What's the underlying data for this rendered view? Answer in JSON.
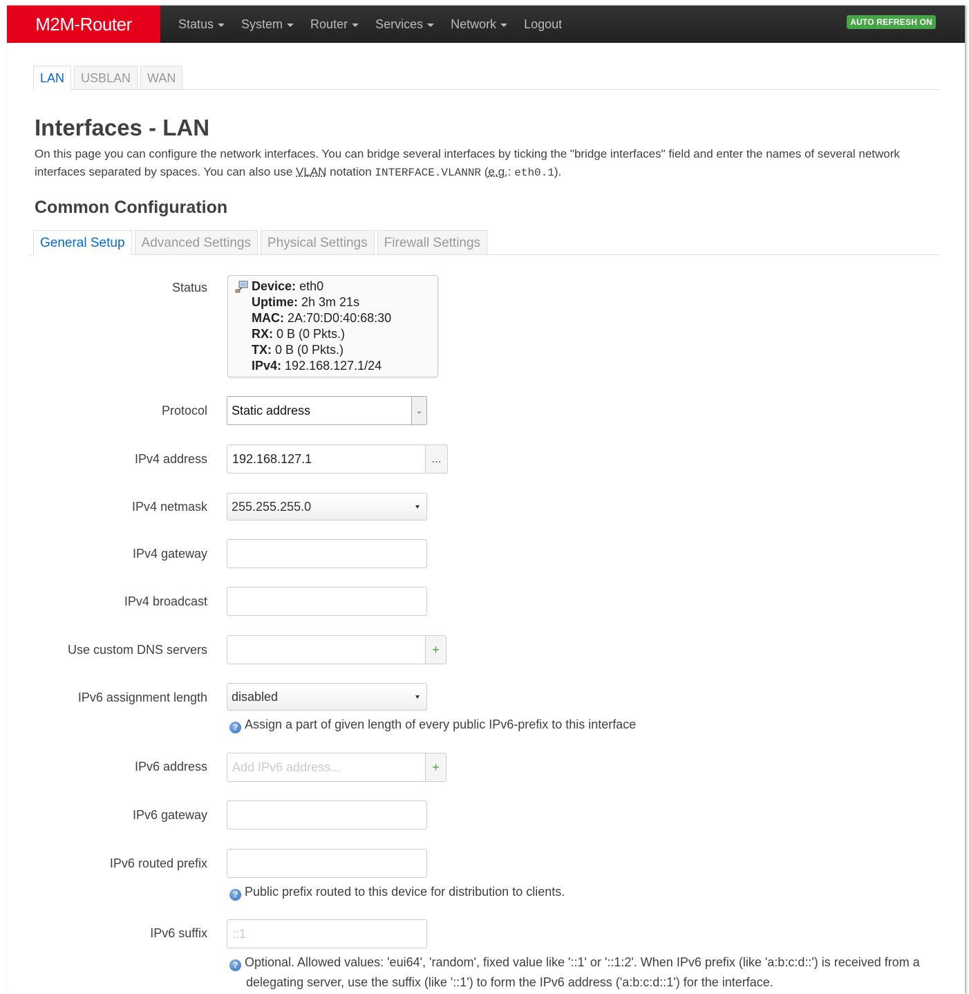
{
  "navbar": {
    "brand": "M2M-Router",
    "menu": [
      {
        "label": "Status",
        "dropdown": true
      },
      {
        "label": "System",
        "dropdown": true
      },
      {
        "label": "Router",
        "dropdown": true
      },
      {
        "label": "Services",
        "dropdown": true
      },
      {
        "label": "Network",
        "dropdown": true
      },
      {
        "label": "Logout",
        "dropdown": false
      }
    ],
    "auto_refresh": "AUTO REFRESH ON"
  },
  "interface_tabs": [
    "LAN",
    "USBLAN",
    "WAN"
  ],
  "page": {
    "title": "Interfaces - LAN",
    "desc_1": "On this page you can configure the network interfaces. You can bridge several interfaces by ticking the \"bridge interfaces\" field and enter the names of several network interfaces separated by spaces. You can also use ",
    "desc_vlan": "VLAN",
    "desc_2": " notation ",
    "desc_code_1": "INTERFACE.VLANNR",
    "desc_3": " (",
    "desc_eg": "e.g.",
    "desc_4": ": ",
    "desc_code_2": "eth0.1",
    "desc_5": ").",
    "section_title": "Common Configuration"
  },
  "config_tabs": [
    "General Setup",
    "Advanced Settings",
    "Physical Settings",
    "Firewall Settings"
  ],
  "form": {
    "status": {
      "label": "Status",
      "device_key": "Device:",
      "device": "eth0",
      "uptime_key": "Uptime:",
      "uptime": "2h 3m 21s",
      "mac_key": "MAC:",
      "mac": "2A:70:D0:40:68:30",
      "rx_key": "RX:",
      "rx": "0 B (0 Pkts.)",
      "tx_key": "TX:",
      "tx": "0 B (0 Pkts.)",
      "ipv4_key": "IPv4:",
      "ipv4": "192.168.127.1/24"
    },
    "protocol": {
      "label": "Protocol",
      "value": "Static address"
    },
    "ipv4_address": {
      "label": "IPv4 address",
      "value": "192.168.127.1",
      "addon": "..."
    },
    "ipv4_netmask": {
      "label": "IPv4 netmask",
      "value": "255.255.255.0"
    },
    "ipv4_gateway": {
      "label": "IPv4 gateway",
      "value": ""
    },
    "ipv4_broadcast": {
      "label": "IPv4 broadcast",
      "value": ""
    },
    "dns": {
      "label": "Use custom DNS servers",
      "value": "",
      "addon": "+"
    },
    "ipv6_assign": {
      "label": "IPv6 assignment length",
      "value": "disabled",
      "hint": "Assign a part of given length of every public IPv6-prefix to this interface"
    },
    "ipv6_address": {
      "label": "IPv6 address",
      "placeholder": "Add IPv6 address...",
      "addon": "+"
    },
    "ipv6_gateway": {
      "label": "IPv6 gateway",
      "value": ""
    },
    "ipv6_prefix": {
      "label": "IPv6 routed prefix",
      "value": "",
      "hint": "Public prefix routed to this device for distribution to clients."
    },
    "ipv6_suffix": {
      "label": "IPv6 suffix",
      "placeholder": "::1",
      "hint": "Optional. Allowed values: 'eui64', 'random', fixed value like '::1' or '::1:2'. When IPv6 prefix (like 'a:b:c:d::') is received from a delegating server, use the suffix (like '::1') to form the IPv6 address ('a:b:c:d::1') for the interface."
    }
  },
  "colors": {
    "brand": "#e5001b",
    "navbar": "#222222",
    "accent": "#0069d6",
    "success": "#46a546"
  }
}
